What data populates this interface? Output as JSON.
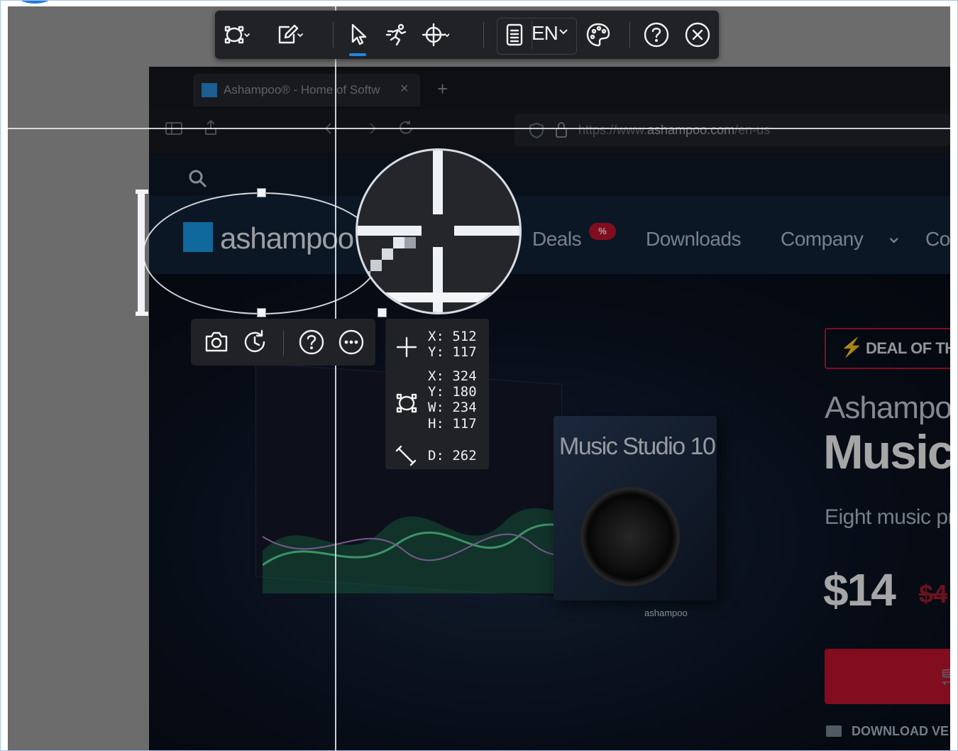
{
  "app": {
    "toolbar": {
      "tools": [
        "capture-region-icon",
        "annotate-icon",
        "select-cursor-icon",
        "scroll-capture-icon",
        "crosshair-icon",
        "document-icon",
        "palette-icon",
        "help-icon",
        "close-icon"
      ],
      "language": "EN",
      "accent": "#1e88e5"
    },
    "selection_toolbar": {
      "tools": [
        "camera-icon",
        "history-icon",
        "help-icon",
        "more-icon"
      ]
    },
    "readout": {
      "cursor_x": "X: 512",
      "cursor_y": "Y: 117",
      "rect_x": "X: 324",
      "rect_y": "Y: 180",
      "rect_w": "W: 234",
      "rect_h": "H: 117",
      "distance": "D: 262"
    }
  },
  "browser": {
    "tab_title": "Ashampoo® - Home of Softw",
    "tab_close": "×",
    "new_tab": "+",
    "url_prefix": "https://www.",
    "url_domain": "ashampoo.com",
    "url_path": "/en-us"
  },
  "site": {
    "logo_text": "ashampoo",
    "nav": {
      "deals": "Deals",
      "deals_badge": "%",
      "downloads": "Downloads",
      "company": "Company",
      "company_chevron": "⌄",
      "more": "Co"
    },
    "deal_label": "DEAL OF TH",
    "product_brand": "Ashampo",
    "product_name": "Music",
    "product_desc": "Eight music pr",
    "price": "$14",
    "old_price": "$4",
    "download_link": "DOWNLOAD VE",
    "box_title": "Music Studio 10",
    "box_brand": "ashampoo",
    "colors": {
      "brand_red": "#c8142f",
      "brand_blue": "#1aa0f0"
    }
  }
}
